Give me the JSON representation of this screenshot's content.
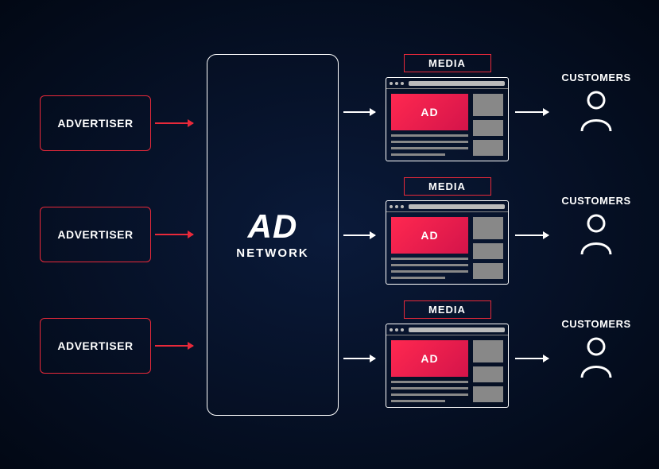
{
  "advertisers": [
    {
      "label": "ADVERTISER"
    },
    {
      "label": "ADVERTISER"
    },
    {
      "label": "ADVERTISER"
    }
  ],
  "network": {
    "title": "AD",
    "subtitle": "NETWORK"
  },
  "media": [
    {
      "label": "MEDIA",
      "ad_label": "AD"
    },
    {
      "label": "MEDIA",
      "ad_label": "AD"
    },
    {
      "label": "MEDIA",
      "ad_label": "AD"
    }
  ],
  "customers": [
    {
      "label": "CUSTOMERS"
    },
    {
      "label": "CUSTOMERS"
    },
    {
      "label": "CUSTOMERS"
    }
  ]
}
